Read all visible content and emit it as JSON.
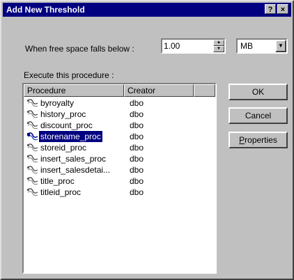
{
  "window": {
    "title": "Add New Threshold",
    "help_label": "?",
    "close_label": "×"
  },
  "threshold": {
    "label": "When free space falls below :",
    "value": "1.00",
    "unit": "MB"
  },
  "procedure_section": {
    "label": "Execute this procedure :"
  },
  "table": {
    "columns": [
      "Procedure",
      "Creator",
      ""
    ],
    "rows": [
      {
        "procedure": "byroyalty",
        "creator": "dbo",
        "selected": false
      },
      {
        "procedure": "history_proc",
        "creator": "dbo",
        "selected": false
      },
      {
        "procedure": "discount_proc",
        "creator": "dbo",
        "selected": false
      },
      {
        "procedure": "storename_proc",
        "creator": "dbo",
        "selected": true
      },
      {
        "procedure": "storeid_proc",
        "creator": "dbo",
        "selected": false
      },
      {
        "procedure": "insert_sales_proc",
        "creator": "dbo",
        "selected": false
      },
      {
        "procedure": "insert_salesdetai...",
        "creator": "dbo",
        "selected": false
      },
      {
        "procedure": "title_proc",
        "creator": "dbo",
        "selected": false
      },
      {
        "procedure": "titleid_proc",
        "creator": "dbo",
        "selected": false
      }
    ]
  },
  "buttons": {
    "ok": "OK",
    "cancel": "Cancel",
    "properties_first": "P",
    "properties_rest": "roperties"
  },
  "colors": {
    "title_bar": "#000080",
    "selection": "#000080",
    "face": "#c0c0c0"
  },
  "icons": {
    "row_icon": "stored-procedure-icon"
  }
}
